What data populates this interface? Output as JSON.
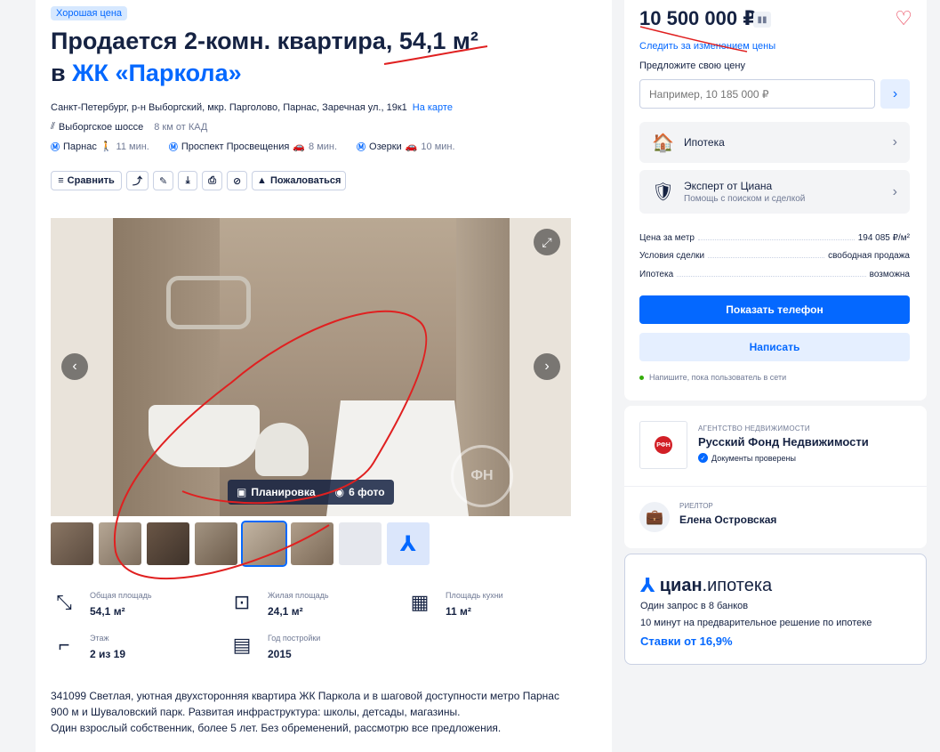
{
  "listing": {
    "badge": "Хорошая цена",
    "title_main": "Продается 2-комн. квартира, 54,1 м²",
    "title_prefix": "в",
    "complex_link": "ЖК «Паркола»",
    "address": "Санкт-Петербург, р-н Выборгский, мкр. Парголово, Парнас, Заречная ул., 19к1",
    "map_link": "На карте",
    "highway": "Выборгское шоссе",
    "highway_distance": "8 км от КАД",
    "metros": [
      {
        "name": "Парнас",
        "time": "11 мин.",
        "mode": "walk"
      },
      {
        "name": "Проспект Просвещения",
        "time": "8 мин.",
        "mode": "car"
      },
      {
        "name": "Озерки",
        "time": "10 мин.",
        "mode": "car"
      }
    ],
    "toolbar": {
      "compare": "Сравнить",
      "complain": "Пожаловаться"
    }
  },
  "gallery": {
    "plan_label": "Планировка",
    "photos_label": "6 фото",
    "watermark": "ФН",
    "thumbs_count": 8,
    "selected_thumb_index": 4
  },
  "facts": [
    {
      "label": "Общая площадь",
      "value": "54,1 м²",
      "icon": "area-icon"
    },
    {
      "label": "Жилая площадь",
      "value": "24,1 м²",
      "icon": "living-area-icon"
    },
    {
      "label": "Площадь кухни",
      "value": "11 м²",
      "icon": "kitchen-icon"
    },
    {
      "label": "Этаж",
      "value": "2 из 19",
      "icon": "stairs-icon"
    },
    {
      "label": "Год постройки",
      "value": "2015",
      "icon": "calendar-icon"
    }
  ],
  "description": [
    "341099 Светлая, уютная двухсторонняя квартира ЖК Паркола и в шаговой доступности метро Парнас",
    "900 м и Шуваловский парк. Развитая инфраструктура: школы, детсады, магазины.",
    "Один взрослый собственник, более 5 лет. Без обременений, рассмотрю все предложения."
  ],
  "sidebar": {
    "price": "10 500 000 ₽",
    "track_link": "Следить за изменением цены",
    "suggest_label": "Предложите свою цену",
    "offer_placeholder": "Например, 10 185 000 ₽",
    "mortgage_btn": "Ипотека",
    "expert_title": "Эксперт от Циана",
    "expert_sub": "Помощь с поиском и сделкой",
    "details": [
      {
        "key": "Цена за метр",
        "value": "194 085 ₽/м²"
      },
      {
        "key": "Условия сделки",
        "value": "свободная продажа"
      },
      {
        "key": "Ипотека",
        "value": "возможна"
      }
    ],
    "show_phone": "Показать телефон",
    "write": "Написать",
    "online_note": "Напишите, пока пользователь в сети"
  },
  "agent": {
    "agency_kind": "АГЕНТСТВО НЕДВИЖИМОСТИ",
    "agency_name": "Русский Фонд Недвижимости",
    "verified": "Документы проверены",
    "realtor_kind": "РИЕЛТОР",
    "realtor_name": "Елена Островская"
  },
  "mortgage_card": {
    "brand_bold": "циан",
    "brand_rest": ".ипотека",
    "line1": "Один запрос в 8 банков",
    "line2": "10 минут на предварительное решение по ипотеке",
    "rate": "Ставки от 16,9%"
  },
  "colors": {
    "accent": "#0468ff",
    "text": "#152242",
    "muted": "#707a95",
    "annotation": "#e02020"
  }
}
